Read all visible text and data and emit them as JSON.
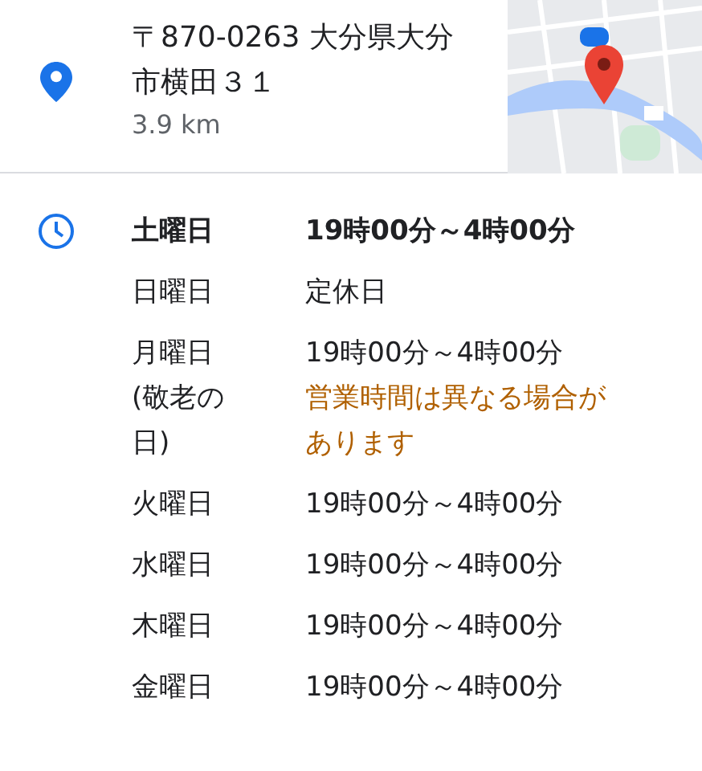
{
  "address": {
    "text": "〒870-0263 大分県大分市横田３１",
    "distance": "3.9 km"
  },
  "hours": [
    {
      "day": "土曜日",
      "time": "19時00分～4時00分",
      "today": true
    },
    {
      "day": "日曜日",
      "time": "定休日",
      "today": false
    },
    {
      "day": "月曜日 (敬老の日)",
      "time": "19時00分～4時00分",
      "note": "営業時間は異なる場合があります",
      "today": false
    },
    {
      "day": "火曜日",
      "time": "19時00分～4時00分",
      "today": false
    },
    {
      "day": "水曜日",
      "time": "19時00分～4時00分",
      "today": false
    },
    {
      "day": "木曜日",
      "time": "19時00分～4時00分",
      "today": false
    },
    {
      "day": "金曜日",
      "time": "19時00分～4時00分",
      "today": false
    }
  ]
}
